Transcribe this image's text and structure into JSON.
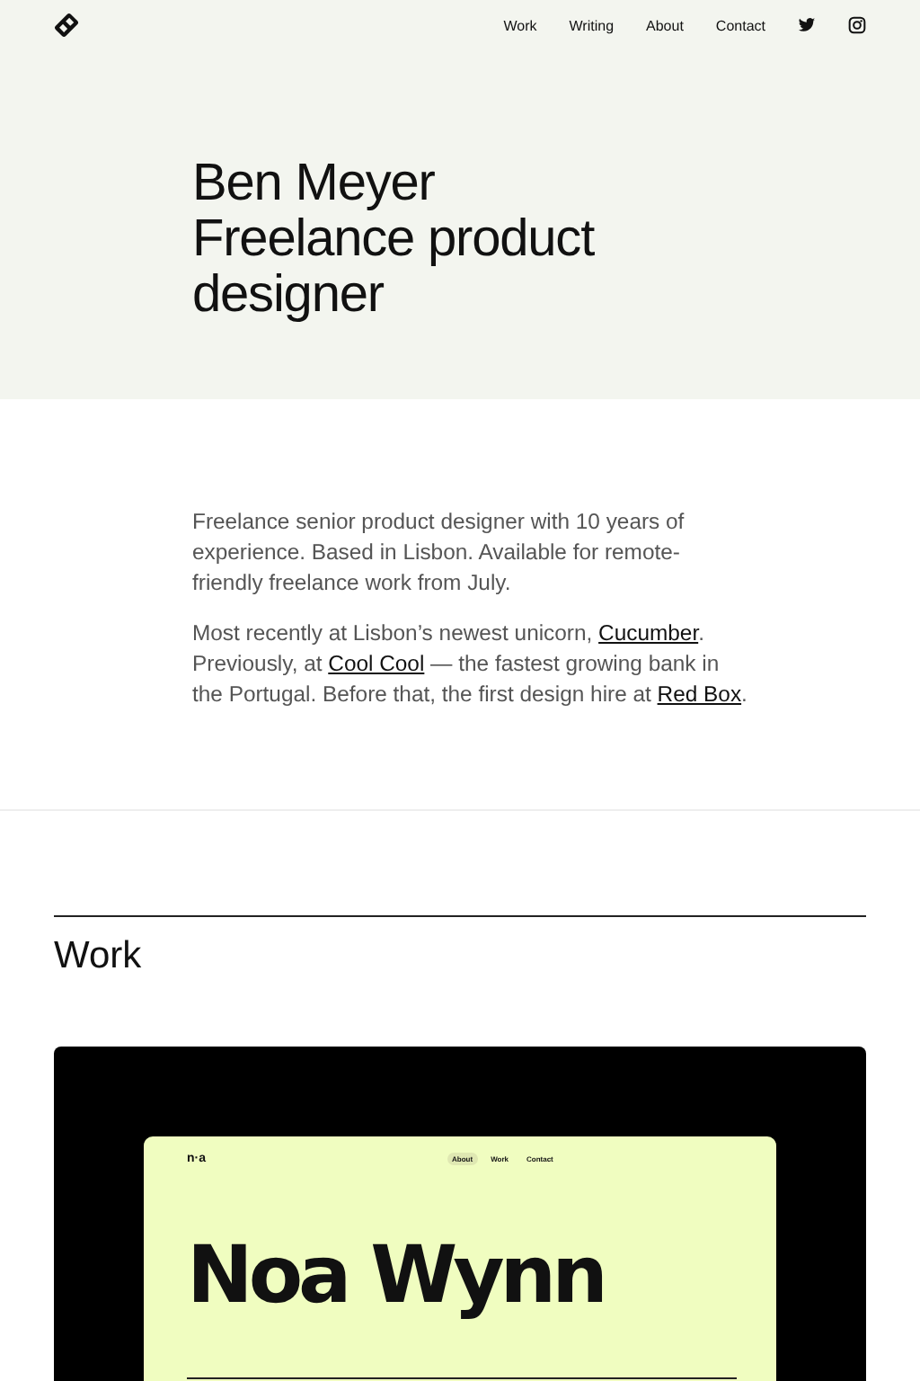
{
  "nav": {
    "links": [
      {
        "label": "Work"
      },
      {
        "label": "Writing"
      },
      {
        "label": "About"
      },
      {
        "label": "Contact"
      }
    ]
  },
  "hero": {
    "title_lines": [
      "Ben Meyer",
      "Freelance product",
      "designer"
    ]
  },
  "intro": {
    "paragraphs": [
      [
        {
          "kind": "text",
          "text": "Freelance senior product designer with 10 years of experience. Based in Lisbon. Available for remote-friendly freelance work from July."
        }
      ],
      [
        {
          "kind": "text",
          "text": "Most recently at Lisbon’s newest unicorn, "
        },
        {
          "kind": "link",
          "text": "Cucumber"
        },
        {
          "kind": "text",
          "text": ". Previously, at "
        },
        {
          "kind": "link",
          "text": "Cool Cool"
        },
        {
          "kind": "text",
          "text": " — the fastest growing bank in the Portugal. Before that, the first design hire at "
        },
        {
          "kind": "link",
          "text": "Red Box"
        },
        {
          "kind": "text",
          "text": "."
        }
      ]
    ]
  },
  "work": {
    "heading": "Work",
    "preview": {
      "logo": "n·a",
      "nav": [
        {
          "label": "About",
          "selected": true
        },
        {
          "label": "Work",
          "selected": false
        },
        {
          "label": "Contact",
          "selected": false
        }
      ],
      "title": "Noa Wynn"
    }
  }
}
